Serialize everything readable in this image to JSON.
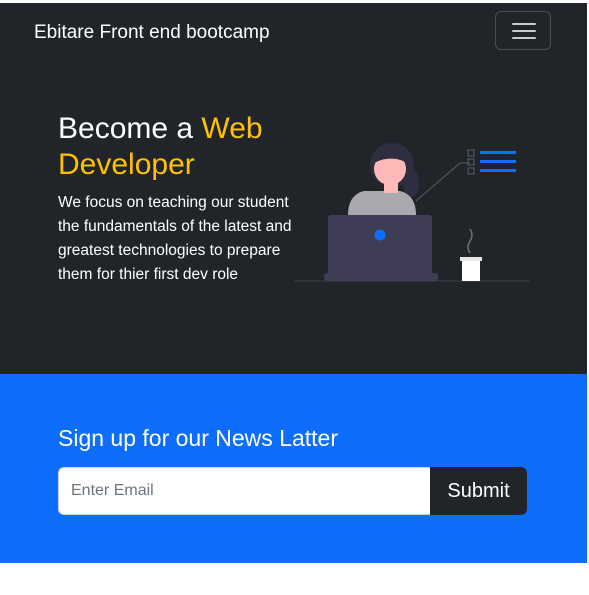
{
  "navbar": {
    "brand": "Ebitare Front end bootcamp",
    "toggler_icon": "hamburger-menu-icon"
  },
  "hero": {
    "title_part1": "Become a ",
    "title_accent": "Web",
    "title_part2": "Developer",
    "description": "We focus on teaching our student the fundamentals of the latest and greatest technologies to prepare them for thier first dev role",
    "illustration": "developer-at-laptop-illustration"
  },
  "newsletter": {
    "title": "Sign up for our News Latter",
    "email_placeholder": "Enter Email",
    "email_value": "",
    "submit_label": "Submit"
  },
  "colors": {
    "dark": "#212529",
    "accent": "#ffc107",
    "primary": "#0d6efd",
    "white": "#ffffff"
  }
}
